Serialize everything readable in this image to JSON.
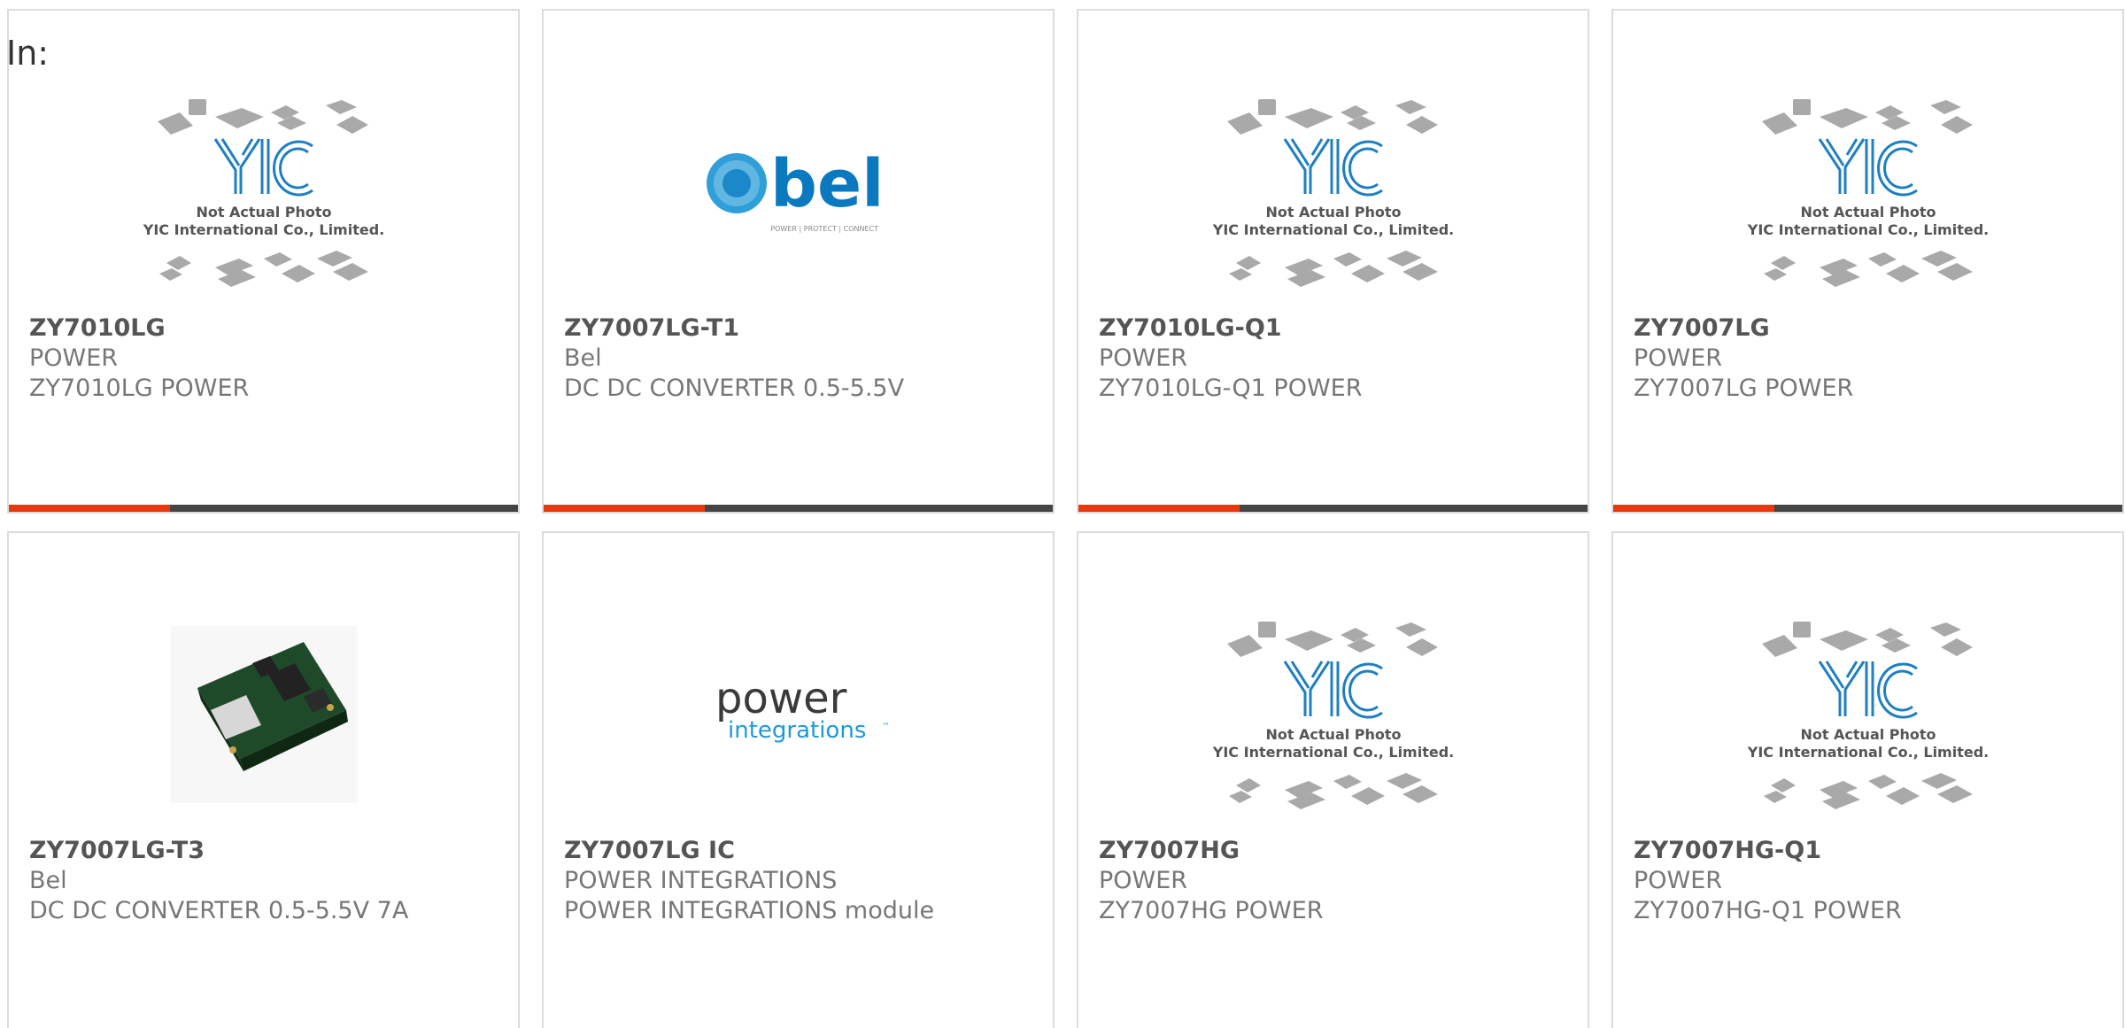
{
  "header": {
    "in_label": "In:"
  },
  "colors": {
    "accent": "#e8380d",
    "bar": "#444444",
    "border": "#dcdcdc",
    "yic_blue": "#1f7fc1",
    "bel_blue": "#0b79bf"
  },
  "placeholder_image": {
    "line1": "Not Actual Photo",
    "line2": "YIC International Co., Limited.",
    "logo": "YIC"
  },
  "bel_logo": {
    "word": "bel",
    "tagline": "POWER | PROTECT | CONNECT"
  },
  "pi_logo": {
    "word1": "power",
    "word2": "integrations",
    "tm": "™"
  },
  "products": [
    {
      "part_number": "ZY7010LG",
      "manufacturer": "POWER",
      "description": "ZY7010LG POWER",
      "image": "yic-placeholder"
    },
    {
      "part_number": "ZY7007LG-T1",
      "manufacturer": "Bel",
      "description": "DC DC CONVERTER 0.5-5.5V",
      "image": "bel-logo"
    },
    {
      "part_number": "ZY7010LG-Q1",
      "manufacturer": "POWER",
      "description": "ZY7010LG-Q1 POWER",
      "image": "yic-placeholder"
    },
    {
      "part_number": "ZY7007LG",
      "manufacturer": "POWER",
      "description": "ZY7007LG POWER",
      "image": "yic-placeholder"
    },
    {
      "part_number": "ZY7007LG-T3",
      "manufacturer": "Bel",
      "description": "DC DC CONVERTER 0.5-5.5V 7A",
      "image": "module-photo"
    },
    {
      "part_number": "ZY7007LG IC",
      "manufacturer": "POWER INTEGRATIONS",
      "description": "POWER INTEGRATIONS module",
      "image": "power-integrations-logo"
    },
    {
      "part_number": "ZY7007HG",
      "manufacturer": "POWER",
      "description": "ZY7007HG POWER",
      "image": "yic-placeholder"
    },
    {
      "part_number": "ZY7007HG-Q1",
      "manufacturer": "POWER",
      "description": "ZY7007HG-Q1 POWER",
      "image": "yic-placeholder"
    }
  ]
}
